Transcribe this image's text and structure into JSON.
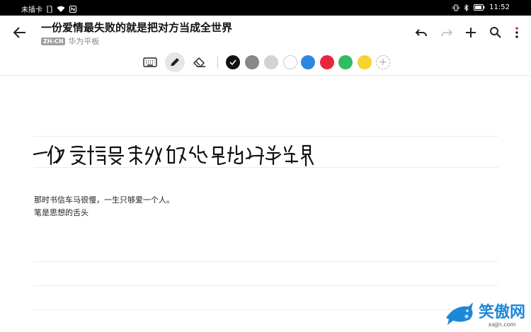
{
  "status_bar": {
    "carrier": "未插卡",
    "time": "11:52"
  },
  "header": {
    "title": "一份爱情最失败的就是把对方当成全世界",
    "language_badge": "ZH-CN",
    "notebook": "华为平板"
  },
  "actions": [
    "undo-icon",
    "redo-icon",
    "add-icon",
    "search-icon",
    "more-icon"
  ],
  "tools": [
    {
      "name": "keyboard-icon",
      "selected": false
    },
    {
      "name": "pen-icon",
      "selected": true
    },
    {
      "name": "eraser-icon",
      "selected": false
    }
  ],
  "palette": {
    "colors": [
      "#111111",
      "#888888",
      "#d3d3d3",
      "#ffffff",
      "#2f86e0",
      "#e8253f",
      "#2dbd62",
      "#f6d32f"
    ],
    "selected_index": 0,
    "add_label": "+"
  },
  "note": {
    "handwritten_title": "一份爱情最失败的就是把对方当成全世界",
    "lines": [
      "那时书信车马很慢，一生只够爱一个人。",
      "笔是思想的舌头"
    ]
  },
  "watermark": {
    "text": "笑傲网",
    "url": "xajjn.com"
  }
}
